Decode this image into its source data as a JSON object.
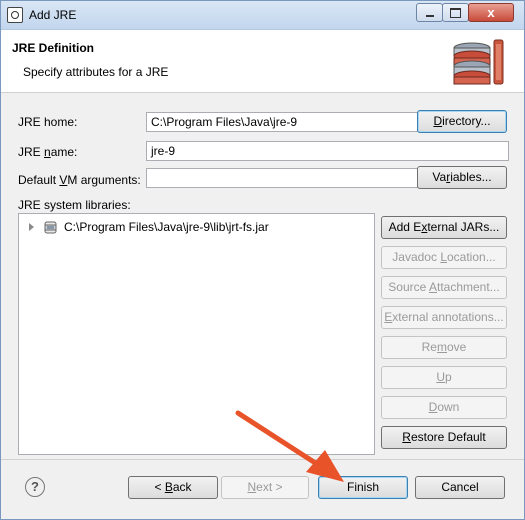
{
  "window": {
    "title": "Add JRE",
    "close_glyph": "x",
    "controls": [
      "minimize-icon",
      "maximize-icon",
      "close-icon"
    ]
  },
  "header": {
    "title": "JRE Definition",
    "subtitle": "Specify attributes for a JRE",
    "icon": "jre-books-icon"
  },
  "form": {
    "jre_home_label_pre": "JRE home:",
    "jre_home_value": "C:\\Program Files\\Java\\jre-9",
    "directory_pre": "",
    "directory_u": "D",
    "directory_post": "irectory...",
    "jre_name_label_pre": "JRE ",
    "jre_name_label_u": "n",
    "jre_name_label_post": "ame:",
    "jre_name_value": "jre-9",
    "vm_args_label_pre": "Default ",
    "vm_args_label_u": "V",
    "vm_args_label_post": "M arguments:",
    "vm_args_value": "",
    "variables_pre": "Va",
    "variables_u": "r",
    "variables_post": "iables...",
    "libraries_label": "JRE system libraries:"
  },
  "libraries": {
    "items": [
      {
        "label": "C:\\Program Files\\Java\\jre-9\\lib\\jrt-fs.jar",
        "icon": "jar-file-icon"
      }
    ]
  },
  "library_buttons": {
    "add_external_pre": "Add E",
    "add_external_u": "x",
    "add_external_post": "ternal JARs...",
    "javadoc_pre": "Javadoc ",
    "javadoc_u": "L",
    "javadoc_post": "ocation...",
    "source_pre": "Source ",
    "source_u": "A",
    "source_post": "ttachment...",
    "external_pre": "",
    "external_u": "E",
    "external_post": "xternal annotations...",
    "remove_pre": "Re",
    "remove_u": "m",
    "remove_post": "ove",
    "up_pre": "",
    "up_u": "U",
    "up_post": "p",
    "down_pre": "",
    "down_u": "D",
    "down_post": "own",
    "restore_pre": "",
    "restore_u": "R",
    "restore_post": "estore Default"
  },
  "footer": {
    "help_glyph": "?",
    "back_pre": "< ",
    "back_u": "B",
    "back_post": "ack",
    "next_pre": "",
    "next_u": "N",
    "next_post": "ext >",
    "finish": "Finish",
    "cancel": "Cancel"
  },
  "colors": {
    "annotation_arrow": "#e8532a",
    "focus_border": "#3c7fb1",
    "disabled_text": "#9a9a9a"
  }
}
